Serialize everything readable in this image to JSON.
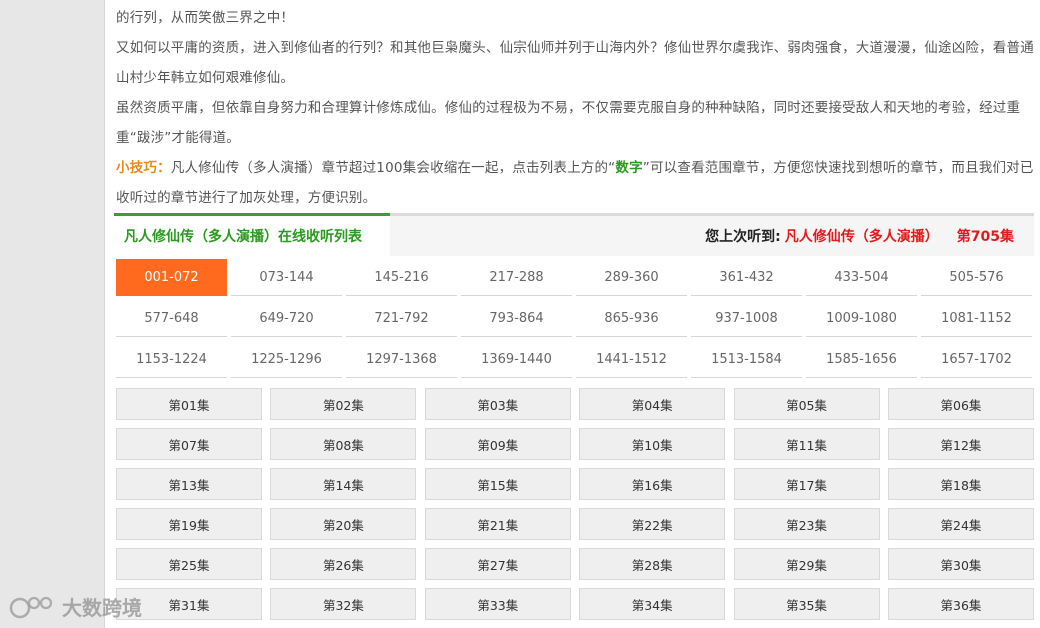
{
  "intro": {
    "line1": "的行列，从而笑傲三界之中！",
    "para2": "又如何以平庸的资质，进入到修仙者的行列？和其他巨枭魔头、仙宗仙师并列于山海内外？修仙世界尔虞我诈、弱肉强食，大道漫漫，仙途凶险，看普通山村少年韩立如何艰难修仙。",
    "para3": "虽然资质平庸，但依靠自身努力和合理算计修炼成仙。修仙的过程极为不易，不仅需要克服自身的种种缺陷，同时还要接受敌人和天地的考验，经过重重“跋涉”才能得道。",
    "tip_label": "小技巧：",
    "tip_text_a": "凡人修仙传（多人演播）章节超过100集会收缩在一起，点击列表上方的“",
    "tip_keyword": "数字",
    "tip_text_b": "”可以查看范围章节，方便您快速找到想听的章节，而且我们对已收听过的章节进行了加灰处理，方便识别。"
  },
  "tabbar": {
    "active_tab": "凡人修仙传（多人演播）在线收听列表",
    "last_label": "您上次听到:",
    "last_title": "凡人修仙传（多人演播）",
    "last_episode": "第705集"
  },
  "ranges": [
    {
      "label": "001-072",
      "active": true
    },
    {
      "label": "073-144",
      "active": false
    },
    {
      "label": "145-216",
      "active": false
    },
    {
      "label": "217-288",
      "active": false
    },
    {
      "label": "289-360",
      "active": false
    },
    {
      "label": "361-432",
      "active": false
    },
    {
      "label": "433-504",
      "active": false
    },
    {
      "label": "505-576",
      "active": false
    },
    {
      "label": "577-648",
      "active": false
    },
    {
      "label": "649-720",
      "active": false
    },
    {
      "label": "721-792",
      "active": false
    },
    {
      "label": "793-864",
      "active": false
    },
    {
      "label": "865-936",
      "active": false
    },
    {
      "label": "937-1008",
      "active": false
    },
    {
      "label": "1009-1080",
      "active": false
    },
    {
      "label": "1081-1152",
      "active": false
    },
    {
      "label": "1153-1224",
      "active": false
    },
    {
      "label": "1225-1296",
      "active": false
    },
    {
      "label": "1297-1368",
      "active": false
    },
    {
      "label": "1369-1440",
      "active": false
    },
    {
      "label": "1441-1512",
      "active": false
    },
    {
      "label": "1513-1584",
      "active": false
    },
    {
      "label": "1585-1656",
      "active": false
    },
    {
      "label": "1657-1702",
      "active": false
    }
  ],
  "episodes": [
    "第01集",
    "第02集",
    "第03集",
    "第04集",
    "第05集",
    "第06集",
    "第07集",
    "第08集",
    "第09集",
    "第10集",
    "第11集",
    "第12集",
    "第13集",
    "第14集",
    "第15集",
    "第16集",
    "第17集",
    "第18集",
    "第19集",
    "第20集",
    "第21集",
    "第22集",
    "第23集",
    "第24集",
    "第25集",
    "第26集",
    "第27集",
    "第28集",
    "第29集",
    "第30集",
    "第31集",
    "第32集",
    "第33集",
    "第34集",
    "第35集",
    "第36集"
  ],
  "watermark": {
    "text": "大数跨境",
    "icon": "brand-logo-icon"
  },
  "colors": {
    "accent_orange": "#ff6a1f",
    "accent_green": "#2a9a20",
    "accent_red": "#e11a1a",
    "tip_orange": "#e8891b"
  }
}
